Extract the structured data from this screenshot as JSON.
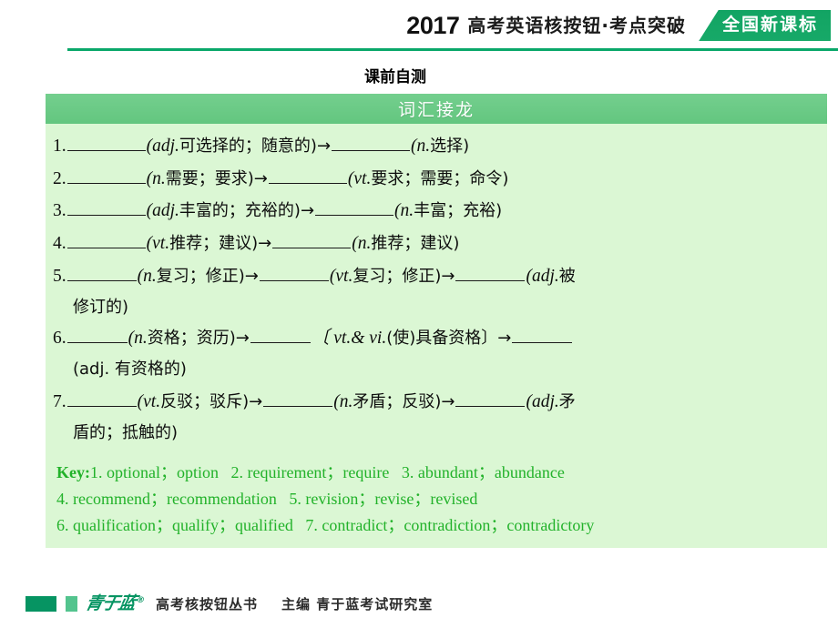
{
  "header": {
    "year": "2017",
    "title": "高考英语核按钮·考点突破",
    "badge": "全国新课标"
  },
  "section": {
    "title": "课前自测"
  },
  "panel": {
    "heading": "词汇接龙"
  },
  "vocab_items": [
    {
      "num": "1.",
      "p1": "(adj.",
      "c1": "可选择的；随意的)",
      "arrow1": "→",
      "p2": "(n.",
      "c2": "选择)",
      "arrow2": "",
      "p3": "",
      "c3": "",
      "tail": ""
    },
    {
      "num": "2.",
      "p1": "(n.",
      "c1": "需要；要求)",
      "arrow1": "→",
      "p2": "(vt.",
      "c2": "要求；需要；命令)",
      "arrow2": "",
      "p3": "",
      "c3": "",
      "tail": ""
    },
    {
      "num": "3.",
      "p1": "(adj.",
      "c1": "丰富的；充裕的)",
      "arrow1": "→",
      "p2": "(n.",
      "c2": "丰富；充裕)",
      "arrow2": "",
      "p3": "",
      "c3": "",
      "tail": ""
    },
    {
      "num": "4.",
      "p1": "(vt.",
      "c1": "推荐；建议)",
      "arrow1": "→",
      "p2": "(n.",
      "c2": "推荐；建议)",
      "arrow2": "",
      "p3": "",
      "c3": "",
      "tail": ""
    },
    {
      "num": "5.",
      "p1": "(n.",
      "c1": "复习；修正)",
      "arrow1": "→",
      "p2": "(vt.",
      "c2": "复习；修正)",
      "arrow2": "→",
      "p3": "(adj.",
      "c3": "被",
      "tail": "修订的)"
    },
    {
      "num": "6.",
      "p1": "(n.",
      "c1": "资格；资历)",
      "arrow1": "→",
      "p2": "〔 vt.& vi.",
      "c2": "(使)具备资格〕",
      "arrow2": "→",
      "p3": "",
      "c3": "",
      "tail": "(adj. 有资格的)"
    },
    {
      "num": "7.",
      "p1": "(vt.",
      "c1": "反驳；驳斥)",
      "arrow1": "→",
      "p2": "(n.",
      "c2": "矛盾；反驳)",
      "arrow2": "→",
      "p3": "(adj.",
      "c3": "矛",
      "tail": "盾的；抵触的)"
    }
  ],
  "key": {
    "label": "Key:",
    "lines": [
      "1. optional；option   2. requirement；require   3. abundant；abundance",
      "4. recommend；recommendation   5. revision；revise；revised",
      "6. qualification；qualify；qualified   7. contradict；contradiction；contradictory"
    ]
  },
  "footer": {
    "logo_text": "青于蓝",
    "registered": "®",
    "series": "高考核按钮丛书",
    "editor": "主编 青于蓝考试研究室"
  },
  "colors": {
    "accent_green": "#0aa86a",
    "badge_green": "#16a765",
    "panel_head": "#6ccb87",
    "panel_bg": "#dbf7d4",
    "key_green": "#22b22a",
    "logo_green": "#069462"
  }
}
